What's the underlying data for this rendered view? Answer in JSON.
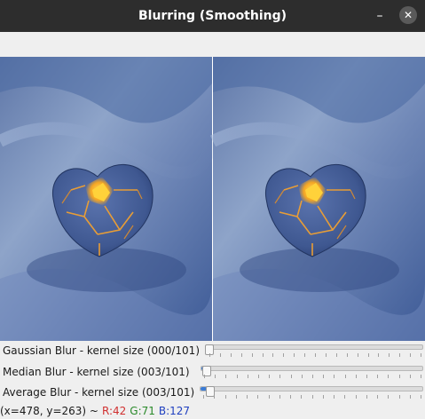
{
  "window": {
    "title": "Blurring (Smoothing)",
    "minimize_glyph": "–",
    "close_glyph": "✕"
  },
  "images": {
    "left": "original-image",
    "right": "blurred-image"
  },
  "trackbars": [
    {
      "label": "Gaussian Blur - kernel size (000/101)",
      "value": 0,
      "max": 101
    },
    {
      "label": "Median Blur - kernel size (003/101)",
      "value": 3,
      "max": 101
    },
    {
      "label": "Average Blur - kernel size (003/101)",
      "value": 3,
      "max": 101
    }
  ],
  "status": {
    "coords": "(x=478, y=263) ~",
    "r": "R:42",
    "g": "G:71",
    "b": "B:127",
    "r_color": "#d03030",
    "g_color": "#2a8a2a",
    "b_color": "#2040c0"
  },
  "colors": {
    "accent": "#3a7bd5",
    "titlebar": "#2d2d2d"
  }
}
